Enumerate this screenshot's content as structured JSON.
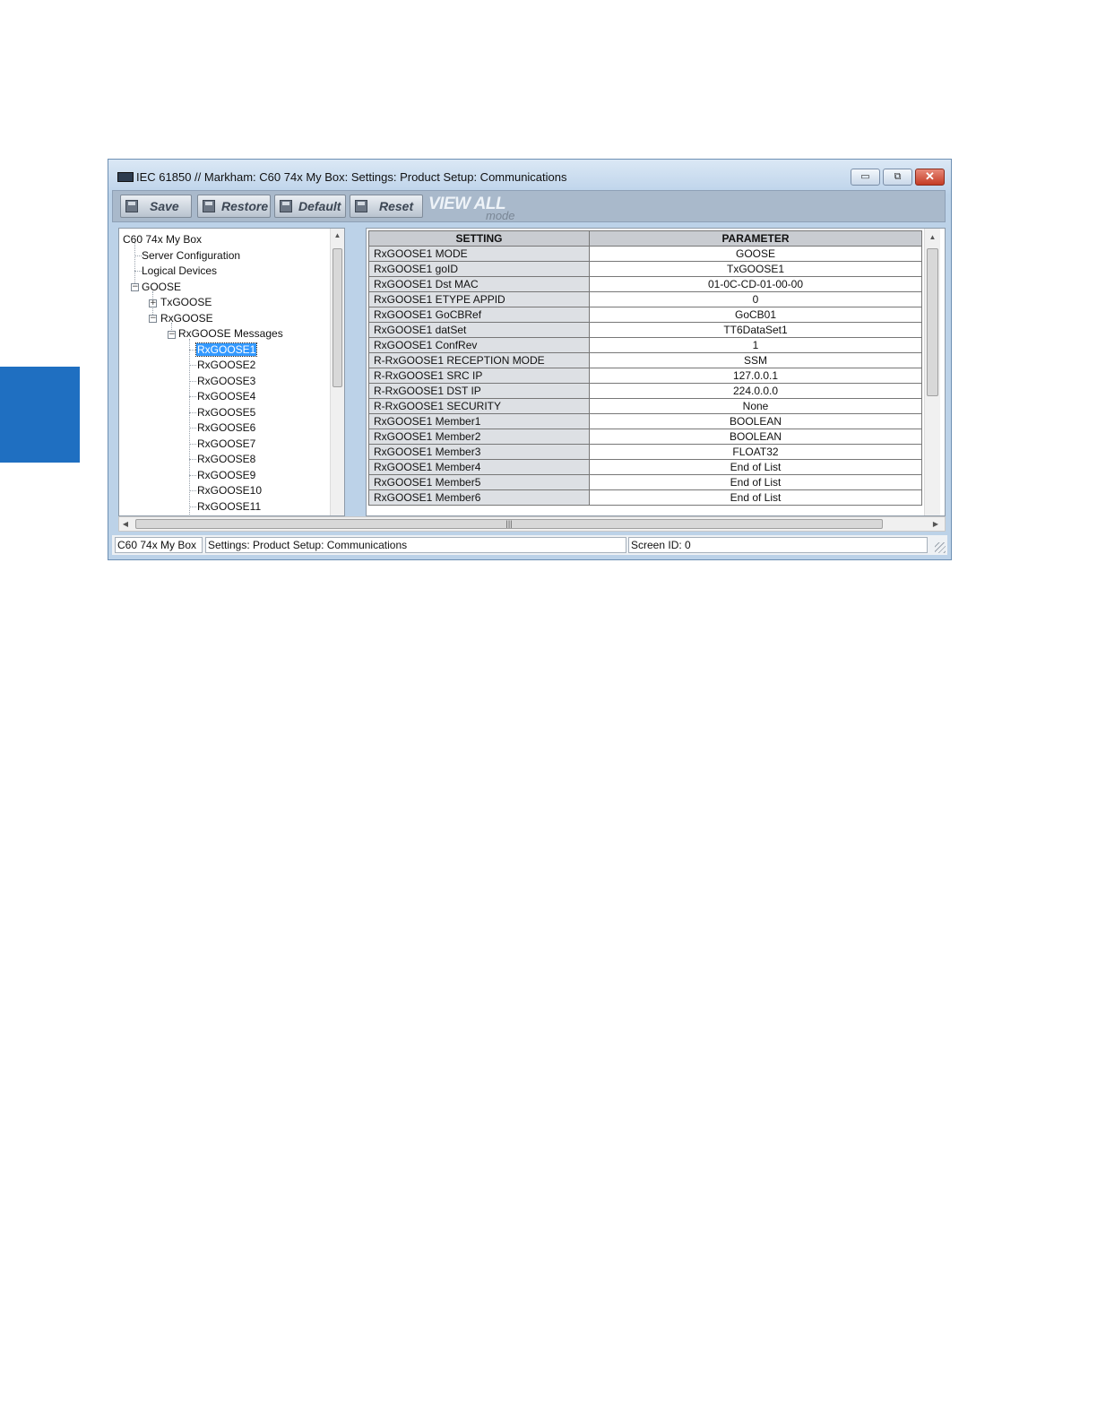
{
  "window": {
    "title": "IEC 61850 // Markham: C60 74x My Box: Settings: Product Setup: Communications",
    "controls": {
      "minimize": "▭",
      "restore": "⧉",
      "close": "✕"
    }
  },
  "toolbar": {
    "save_label": "Save",
    "restore_label": "Restore",
    "default_label": "Default",
    "reset_label": "Reset",
    "view_all_label": "VIEW ALL",
    "view_mode_label": "mode"
  },
  "tree": {
    "root": "C60 74x My Box",
    "server_configuration": "Server Configuration",
    "logical_devices": "Logical Devices",
    "goose": "GOOSE",
    "txgoose": "TxGOOSE",
    "rxgoose": "RxGOOSE",
    "rxgoose_messages": "RxGOOSE Messages",
    "messages": [
      "RxGOOSE1",
      "RxGOOSE2",
      "RxGOOSE3",
      "RxGOOSE4",
      "RxGOOSE5",
      "RxGOOSE6",
      "RxGOOSE7",
      "RxGOOSE8",
      "RxGOOSE9",
      "RxGOOSE10",
      "RxGOOSE11"
    ],
    "selected": "RxGOOSE1"
  },
  "grid": {
    "headers": {
      "setting": "SETTING",
      "parameter": "PARAMETER"
    },
    "rows": [
      {
        "setting": "RxGOOSE1 MODE",
        "parameter": "GOOSE"
      },
      {
        "setting": "RxGOOSE1 goID",
        "parameter": "TxGOOSE1"
      },
      {
        "setting": "RxGOOSE1 Dst MAC",
        "parameter": "01-0C-CD-01-00-00"
      },
      {
        "setting": "RxGOOSE1 ETYPE APPID",
        "parameter": "0"
      },
      {
        "setting": "RxGOOSE1 GoCBRef",
        "parameter": "GoCB01"
      },
      {
        "setting": "RxGOOSE1 datSet",
        "parameter": "TT6DataSet1"
      },
      {
        "setting": "RxGOOSE1 ConfRev",
        "parameter": "1"
      },
      {
        "setting": "R-RxGOOSE1 RECEPTION MODE",
        "parameter": "SSM"
      },
      {
        "setting": "R-RxGOOSE1 SRC IP",
        "parameter": "127.0.0.1"
      },
      {
        "setting": "R-RxGOOSE1 DST IP",
        "parameter": "224.0.0.0"
      },
      {
        "setting": "R-RxGOOSE1 SECURITY",
        "parameter": "None"
      },
      {
        "setting": "RxGOOSE1 Member1",
        "parameter": "BOOLEAN"
      },
      {
        "setting": "RxGOOSE1 Member2",
        "parameter": "BOOLEAN"
      },
      {
        "setting": "RxGOOSE1 Member3",
        "parameter": "FLOAT32"
      },
      {
        "setting": "RxGOOSE1 Member4",
        "parameter": "End of List"
      },
      {
        "setting": "RxGOOSE1 Member5",
        "parameter": "End of List"
      },
      {
        "setting": "RxGOOSE1 Member6",
        "parameter": "End of List"
      }
    ]
  },
  "statusbar": {
    "device": "C60 74x My Box",
    "path": "Settings: Product Setup: Communications",
    "screen_id": "Screen ID: 0"
  },
  "colors": {
    "side_tab": "#1f6fc1",
    "selection": "#3399ff",
    "window_frame": "#bcd2e8"
  },
  "icons": {
    "tree_expand": "plus-box",
    "tree_collapse": "minus-box"
  }
}
